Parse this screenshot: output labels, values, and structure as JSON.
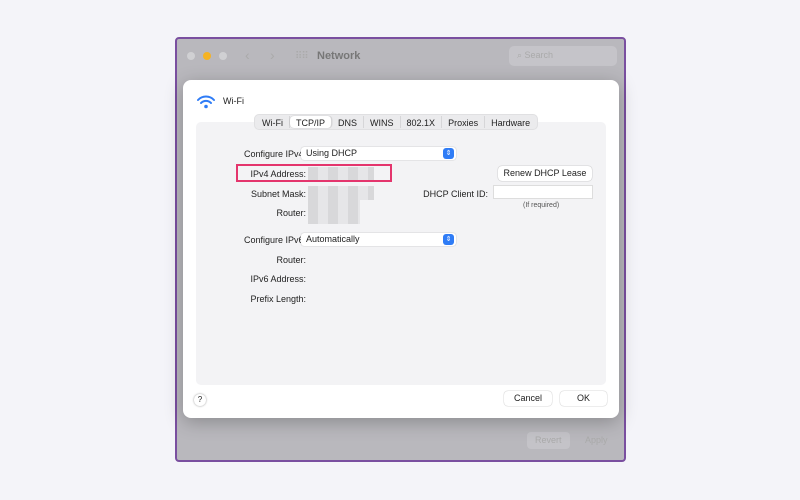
{
  "window": {
    "title": "Network",
    "search_placeholder": "Search",
    "revert_label": "Revert",
    "apply_label": "Apply"
  },
  "dialog": {
    "title": "Wi-Fi",
    "tabs": [
      "Wi-Fi",
      "TCP/IP",
      "DNS",
      "WINS",
      "802.1X",
      "Proxies",
      "Hardware"
    ],
    "active_tab": "TCP/IP",
    "configure_ipv4_label": "Configure IPv4:",
    "configure_ipv4_value": "Using DHCP",
    "ipv4_address_label": "IPv4 Address:",
    "subnet_mask_label": "Subnet Mask:",
    "router_label": "Router:",
    "renew_label": "Renew DHCP Lease",
    "dhcp_client_id_label": "DHCP Client ID:",
    "dhcp_client_id_value": "",
    "dhcp_hint": "(If required)",
    "configure_ipv6_label": "Configure IPv6:",
    "configure_ipv6_value": "Automatically",
    "router6_label": "Router:",
    "ipv6_address_label": "IPv6 Address:",
    "prefix_length_label": "Prefix Length:",
    "help_label": "?",
    "cancel_label": "Cancel",
    "ok_label": "OK"
  },
  "colors": {
    "highlight": "#e4356d",
    "accent": "#2f7cf6",
    "minimize": "#f5b323"
  }
}
